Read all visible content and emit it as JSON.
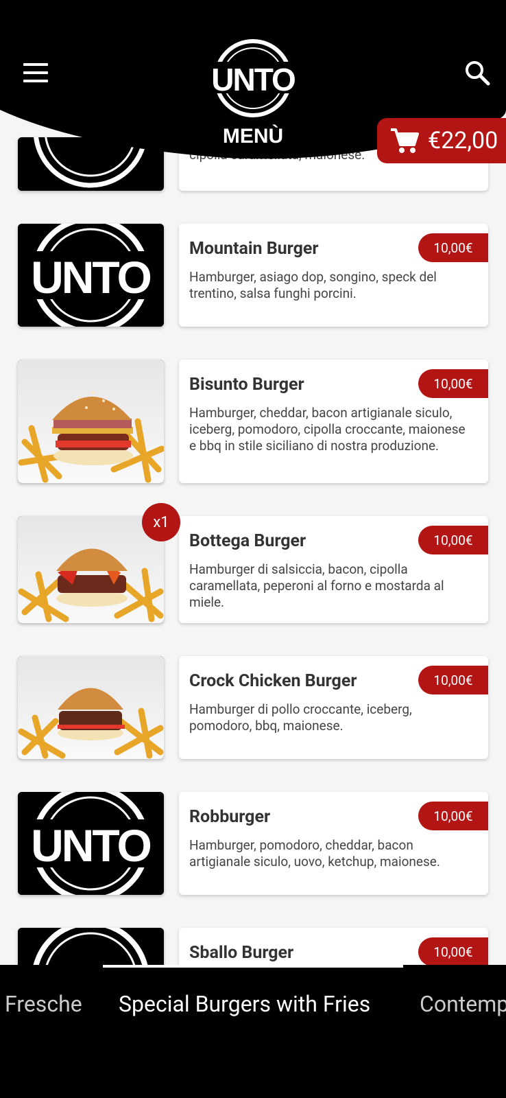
{
  "header": {
    "logo_text": "UNTO",
    "title": "MENÙ",
    "menu_icon": "hamburger-menu-icon",
    "search_icon": "search-icon"
  },
  "cart": {
    "icon": "cart-icon",
    "total": "€22,00"
  },
  "colors": {
    "accent": "#b31515",
    "header": "#000000",
    "background": "#f5f5f5"
  },
  "items": [
    {
      "name": "",
      "desc": "cipolla caramellata, maionese.",
      "price": ""
    },
    {
      "name": "Mountain Burger",
      "desc": "Hamburger, asiago dop, songino, speck del trentino, salsa funghi porcini.",
      "price": "10,00€"
    },
    {
      "name": "Bisunto Burger",
      "desc": "Hamburger, cheddar, bacon artigianale siculo, iceberg, pomodoro, cipolla croccante, maionese e bbq in stile siciliano di nostra produzione.",
      "price": "10,00€"
    },
    {
      "name": "Bottega Burger",
      "desc": "Hamburger di salsiccia, bacon, cipolla caramellata, peperoni al forno e mostarda al miele.",
      "price": "10,00€",
      "qty": "x1"
    },
    {
      "name": "Crock Chicken Burger",
      "desc": "Hamburger di pollo croccante, iceberg, pomodoro, bbq, maionese.",
      "price": "10,00€"
    },
    {
      "name": "Robburger",
      "desc": "Hamburger, pomodoro, cheddar, bacon artigianale siculo, uovo, ketchup, maionese.",
      "price": "10,00€"
    },
    {
      "name": "Sballo Burger",
      "desc": "",
      "price": "10,00€"
    }
  ],
  "tabs": [
    "Fresche",
    "Special Burgers with Fries",
    "Contemp"
  ]
}
